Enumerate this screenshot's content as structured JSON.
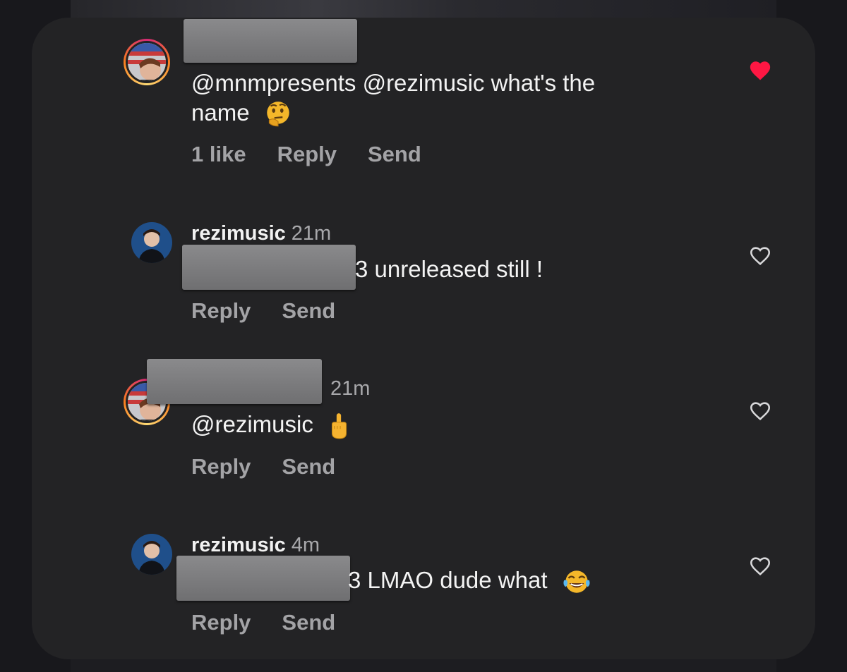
{
  "comments": [
    {
      "username": "",
      "time": "",
      "text": "@mnmpresents @rezimusic what's the",
      "text_line2": "name",
      "emoji": "thinking-face",
      "likes": "1 like",
      "reply": "Reply",
      "send": "Send",
      "liked": true
    },
    {
      "username": "rezimusic",
      "time": "21m",
      "text": "unreleased still !",
      "text_prefix": "3",
      "reply": "Reply",
      "send": "Send",
      "liked": false
    },
    {
      "username": "",
      "time": "21m",
      "text": "@rezimusic",
      "emoji": "pointing-up",
      "reply": "Reply",
      "send": "Send",
      "liked": false
    },
    {
      "username": "rezimusic",
      "time": "4m",
      "text": "LMAO dude what",
      "text_prefix": "3",
      "emoji": "tears-of-joy",
      "reply": "Reply",
      "send": "Send",
      "liked": false
    }
  ],
  "colors": {
    "heart_liked": "#fe1743",
    "card_bg": "#232325",
    "text": "#f3f3f3",
    "muted": "#a3a3a6"
  }
}
